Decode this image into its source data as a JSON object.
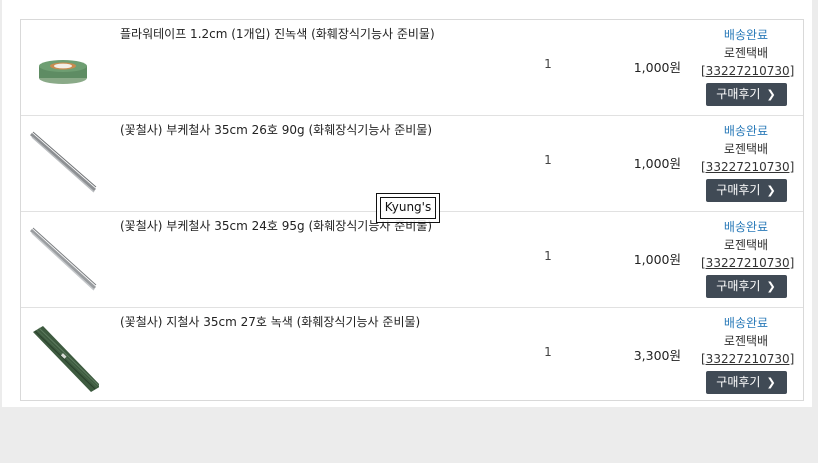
{
  "orders": [
    {
      "title": "플라워테이프 1.2cm (1개입) 진녹색 (화훼장식기능사 준비물)",
      "quantity": "1",
      "price": "1,000원",
      "status": "배송완료",
      "courier": "로젠택배",
      "tracking": "[33227210730]",
      "review_label": "구매후기",
      "thumb_type": "tape"
    },
    {
      "title": "(꽃철사) 부케철사 35cm 26호 90g (화훼장식기능사 준비물)",
      "quantity": "1",
      "price": "1,000원",
      "status": "배송완료",
      "courier": "로젠택배",
      "tracking": "[33227210730]",
      "review_label": "구매후기",
      "thumb_type": "wire"
    },
    {
      "title": "(꽃철사) 부케철사 35cm 24호 95g (화훼장식기능사 준비물)",
      "quantity": "1",
      "price": "1,000원",
      "status": "배송완료",
      "courier": "로젠택배",
      "tracking": "[33227210730]",
      "review_label": "구매후기",
      "thumb_type": "wire"
    },
    {
      "title": "(꽃철사) 지철사 35cm 27호 녹색 (화훼장식기능사 준비물)",
      "quantity": "1",
      "price": "3,300원",
      "status": "배송완료",
      "courier": "로젠택배",
      "tracking": "[33227210730]",
      "review_label": "구매후기",
      "thumb_type": "green-wire"
    }
  ],
  "watermark": "Kyung's",
  "colors": {
    "status": "#2b7bb9",
    "button_bg": "#404a55",
    "border": "#d9d9d9"
  }
}
